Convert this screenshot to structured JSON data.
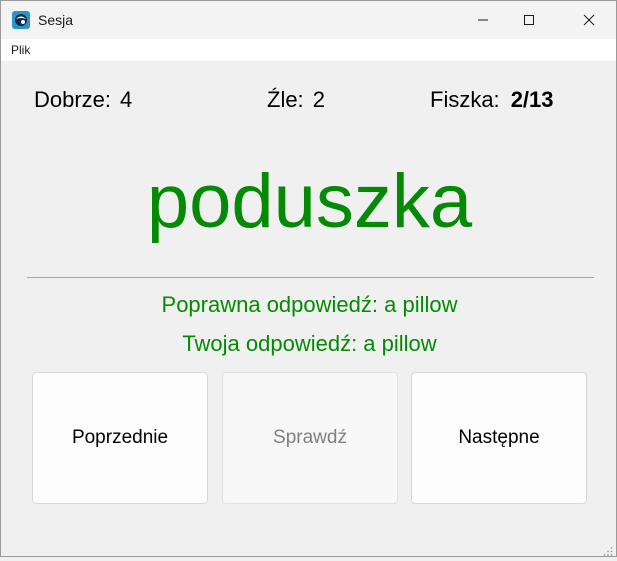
{
  "window": {
    "title": "Sesja",
    "icon": "app-icon"
  },
  "menu": {
    "items": [
      "Plik"
    ]
  },
  "stats": {
    "good_label": "Dobrze:",
    "good_value": "4",
    "bad_label": "Źle:",
    "bad_value": "2",
    "card_label": "Fiszka:",
    "card_value": "2/13"
  },
  "flashcard": {
    "word": "poduszka",
    "correct_answer": "Poprawna odpowiedź: a pillow",
    "your_answer": "Twoja odpowiedź: a pillow"
  },
  "buttons": {
    "previous": "Poprzednie",
    "check": "Sprawdź",
    "next": "Następne"
  },
  "colors": {
    "correct": "#058a05",
    "disabled_text": "#808080",
    "background": "#f0f0f0"
  }
}
